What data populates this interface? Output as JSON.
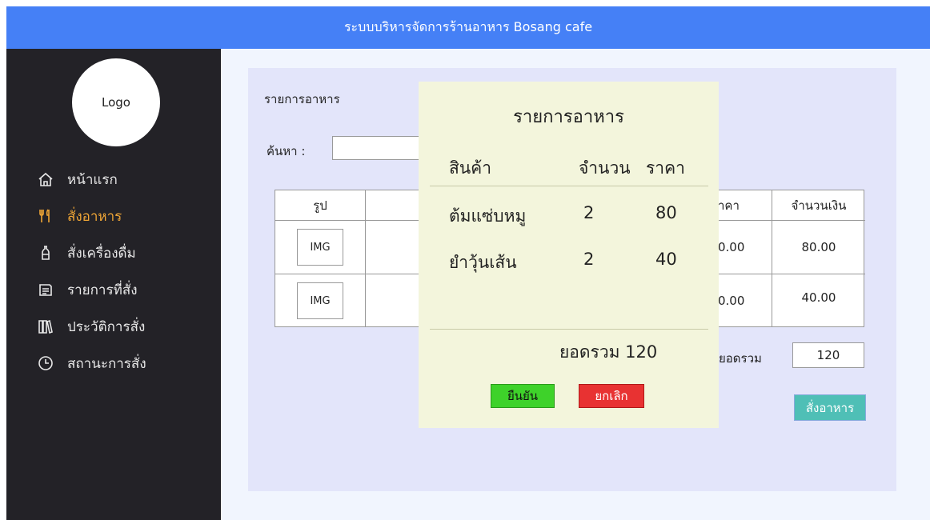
{
  "header": {
    "title": "ระบบบริหารจัดการร้านอาหาร Bosang cafe"
  },
  "sidebar": {
    "logo": "Logo",
    "items": [
      {
        "label": "หน้าแรก",
        "icon": "home-icon"
      },
      {
        "label": "สั่งอาหาร",
        "icon": "utensils-icon",
        "active": true
      },
      {
        "label": "สั่งเครื่องดื่ม",
        "icon": "drink-icon"
      },
      {
        "label": "รายการที่สั่ง",
        "icon": "order-list-icon"
      },
      {
        "label": "ประวัติการสั่ง",
        "icon": "history-icon"
      },
      {
        "label": "สถานะการสั่ง",
        "icon": "clock-icon"
      }
    ],
    "active_color": "#f0a636"
  },
  "main": {
    "section_title": "รายการอาหาร",
    "search_label": "ค้นหา :",
    "search_value": "",
    "table": {
      "headers": [
        "รูป",
        "",
        "ราคา",
        "จำนวนเงิน"
      ],
      "header_price_partial": "าคา",
      "rows": [
        {
          "image": "IMG",
          "price_partial": "0.00",
          "amount": "80.00"
        },
        {
          "image": "IMG",
          "price_partial": "0.00",
          "amount": "40.00"
        }
      ]
    },
    "total_label": "ยอดรวม",
    "total_value": "120",
    "order_button": "สั่งอาหาร"
  },
  "modal": {
    "title": "รายการอาหาร",
    "headers": {
      "item": "สินค้า",
      "qty": "จำนวน",
      "price": "ราคา"
    },
    "items": [
      {
        "name": "ต้มแซ่บหมู",
        "qty": "2",
        "price": "80"
      },
      {
        "name": "ยำวุ้นเส้น",
        "qty": "2",
        "price": "40"
      }
    ],
    "total_text": "ยอดรวม 120",
    "confirm_label": "ยืนยัน",
    "cancel_label": "ยกเลิก"
  },
  "colors": {
    "header": "#4580f6",
    "sidebar": "#232227",
    "modal": "#f3f5dc",
    "confirm": "#3ed22a",
    "cancel": "#e83232",
    "order_button": "#4fbfb6"
  }
}
